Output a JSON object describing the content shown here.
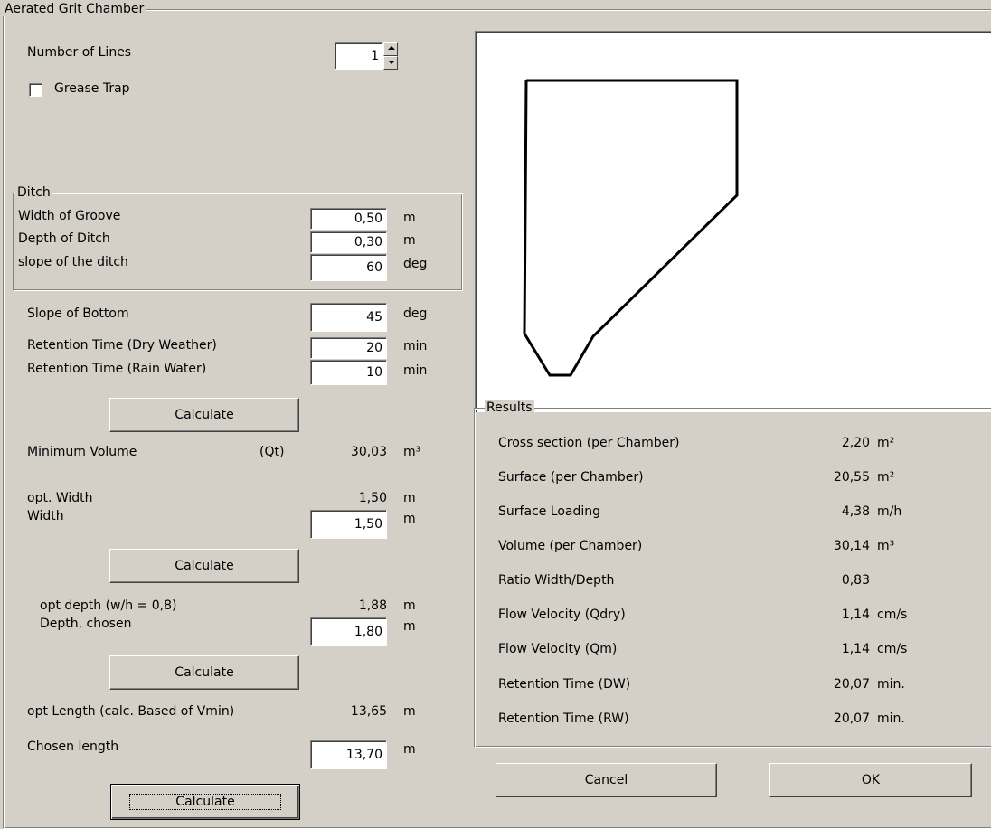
{
  "title": "Aerated Grit Chamber",
  "number_of_lines": {
    "label": "Number of Lines",
    "value": "1"
  },
  "grease_trap": {
    "label": "Grease Trap",
    "checked": false
  },
  "ditch": {
    "legend": "Ditch",
    "width_of_groove": {
      "label": "Width of Groove",
      "value": "0,50",
      "unit": "m"
    },
    "depth_of_ditch": {
      "label": "Depth of Ditch",
      "value": "0,30",
      "unit": "m"
    },
    "slope_of_ditch": {
      "label": "slope of the ditch",
      "value": "60",
      "unit": "deg"
    }
  },
  "slope_of_bottom": {
    "label": "Slope of Bottom",
    "value": "45",
    "unit": "deg"
  },
  "retention_dry": {
    "label": "Retention Time (Dry Weather)",
    "value": "20",
    "unit": "min"
  },
  "retention_rain": {
    "label": "Retention Time (Rain Water)",
    "value": "10",
    "unit": "min"
  },
  "calculate_label": "Calculate",
  "minimum_volume": {
    "label": "Minimum Volume",
    "qualifier": "(Qt)",
    "value": "30,03",
    "unit": "m³"
  },
  "opt_width": {
    "label": "opt. Width",
    "value": "1,50",
    "unit": "m"
  },
  "width": {
    "label": "Width",
    "value": "1,50",
    "unit": "m"
  },
  "opt_depth": {
    "label": "opt depth (w/h = 0,8)",
    "value": "1,88",
    "unit": "m"
  },
  "depth_chosen": {
    "label": "Depth, chosen",
    "value": "1,80",
    "unit": "m"
  },
  "opt_length": {
    "label": "opt Length (calc. Based of Vmin)",
    "value": "13,65",
    "unit": "m"
  },
  "chosen_length": {
    "label": "Chosen length",
    "value": "13,70",
    "unit": "m"
  },
  "results": {
    "legend": "Results",
    "rows": [
      {
        "label": "Cross section (per Chamber)",
        "value": "2,20",
        "unit": "m²"
      },
      {
        "label": "Surface (per Chamber)",
        "value": "20,55",
        "unit": "m²"
      },
      {
        "label": "Surface Loading",
        "value": "4,38",
        "unit": "m/h"
      },
      {
        "label": "Volume (per Chamber)",
        "value": "30,14",
        "unit": "m³"
      },
      {
        "label": "Ratio Width/Depth",
        "value": "0,83",
        "unit": ""
      },
      {
        "label": "Flow Velocity (Qdry)",
        "value": "1,14",
        "unit": "cm/s"
      },
      {
        "label": "Flow Velocity (Qm)",
        "value": "1,14",
        "unit": "cm/s"
      },
      {
        "label": "Retention Time (DW)",
        "value": "20,07",
        "unit": "min."
      },
      {
        "label": "Retention Time (RW)",
        "value": "20,07",
        "unit": "min."
      }
    ]
  },
  "buttons": {
    "cancel": "Cancel",
    "ok": "OK"
  }
}
